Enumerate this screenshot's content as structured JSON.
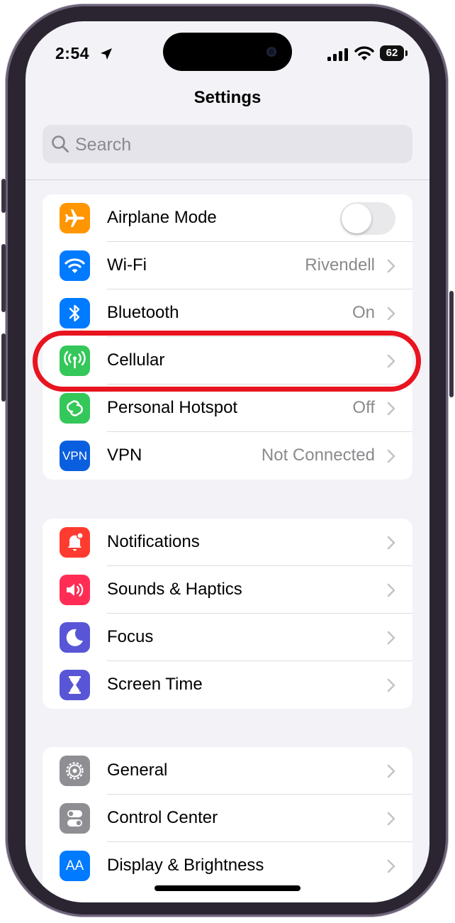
{
  "status_bar": {
    "time": "2:54",
    "battery": "62"
  },
  "nav": {
    "title": "Settings"
  },
  "search": {
    "placeholder": "Search"
  },
  "group1": [
    {
      "label": "Airplane Mode",
      "value": "",
      "icon": "airplane-icon",
      "color": "#FF9500",
      "control": "toggle",
      "toggle_on": false
    },
    {
      "label": "Wi-Fi",
      "value": "Rivendell",
      "icon": "wifi-icon",
      "color": "#007AFF",
      "control": "chevron"
    },
    {
      "label": "Bluetooth",
      "value": "On",
      "icon": "bluetooth-icon",
      "color": "#007AFF",
      "control": "chevron"
    },
    {
      "label": "Cellular",
      "value": "",
      "icon": "cellular-antenna-icon",
      "color": "#34C759",
      "control": "chevron"
    },
    {
      "label": "Personal Hotspot",
      "value": "Off",
      "icon": "hotspot-link-icon",
      "color": "#34C759",
      "control": "chevron"
    },
    {
      "label": "VPN",
      "value": "Not Connected",
      "icon": "vpn-icon",
      "icon_text": "VPN",
      "color": "#0A5FE0",
      "control": "chevron"
    }
  ],
  "group2": [
    {
      "label": "Notifications",
      "icon": "bell-icon",
      "color": "#FF3B30",
      "control": "chevron"
    },
    {
      "label": "Sounds & Haptics",
      "icon": "speaker-icon",
      "color": "#FF2D55",
      "control": "chevron"
    },
    {
      "label": "Focus",
      "icon": "moon-icon",
      "color": "#5856D6",
      "control": "chevron"
    },
    {
      "label": "Screen Time",
      "icon": "hourglass-icon",
      "color": "#5856D6",
      "control": "chevron"
    }
  ],
  "group3": [
    {
      "label": "General",
      "icon": "gear-icon",
      "color": "#8E8E93",
      "control": "chevron"
    },
    {
      "label": "Control Center",
      "icon": "toggles-icon",
      "color": "#8E8E93",
      "control": "chevron"
    },
    {
      "label": "Display & Brightness",
      "icon": "text-size-icon",
      "icon_text": "AA",
      "color": "#007AFF",
      "control": "chevron"
    }
  ],
  "annotation": {
    "highlight_color": "#E8141F",
    "highlighted_row": "Cellular"
  }
}
